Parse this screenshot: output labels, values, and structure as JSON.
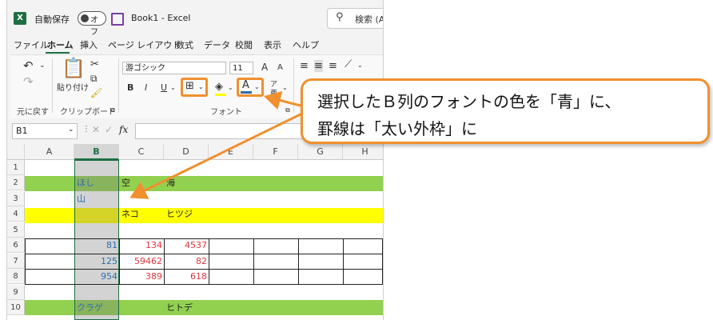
{
  "titlebar": {
    "app_icon": "X",
    "autosave_label": "自動保存",
    "autosave_state": "オフ",
    "doc_title": "Book1  -  Excel",
    "search_placeholder": "検索 (Alt"
  },
  "menu": [
    "ファイル",
    "ホーム",
    "挿入",
    "ページ レイアウト",
    "数式",
    "データ",
    "校閲",
    "表示",
    "ヘルプ"
  ],
  "ribbon": {
    "undo_label": "元に戻す",
    "paste_label": "貼り付け",
    "clipboard_label": "クリップボード",
    "font_name": "游ゴシック",
    "font_size": "11",
    "grow_font": "A",
    "shrink_font": "A",
    "bold": "B",
    "italic": "I",
    "underline": "U",
    "font_color_letter": "A",
    "phonetic_top": "ア",
    "phonetic_bottom": "亜",
    "font_group_label": "フォント"
  },
  "formula_bar": {
    "name_box": "B1",
    "fx": "fx"
  },
  "grid": {
    "columns": [
      "A",
      "B",
      "C",
      "D",
      "E",
      "F",
      "G",
      "H"
    ],
    "rows": [
      "1",
      "2",
      "3",
      "4",
      "5",
      "6",
      "7",
      "8",
      "9",
      "10"
    ],
    "cells": {
      "B2": "ほし",
      "C2": "空",
      "D2": "海",
      "B3": "山",
      "C4": "ネコ",
      "D4": "ヒツジ",
      "B6": "81",
      "C6": "134",
      "D6": "4537",
      "B7": "125",
      "C7": "59462",
      "D7": "82",
      "B8": "954",
      "C8": "389",
      "D8": "618",
      "B10": "クラゲ",
      "D10": "ヒトデ"
    }
  },
  "callout": {
    "line1": "選択したＢ列のフォントの色を「青」に、",
    "line2": "罫線は「太い外枠」に"
  },
  "colors": {
    "accent": "#f0902e",
    "excel_green": "#1d6f42",
    "row_green": "#92d050",
    "row_yellow": "#ffff00",
    "number_red": "#e0353d",
    "number_blue": "#2e6dad"
  }
}
